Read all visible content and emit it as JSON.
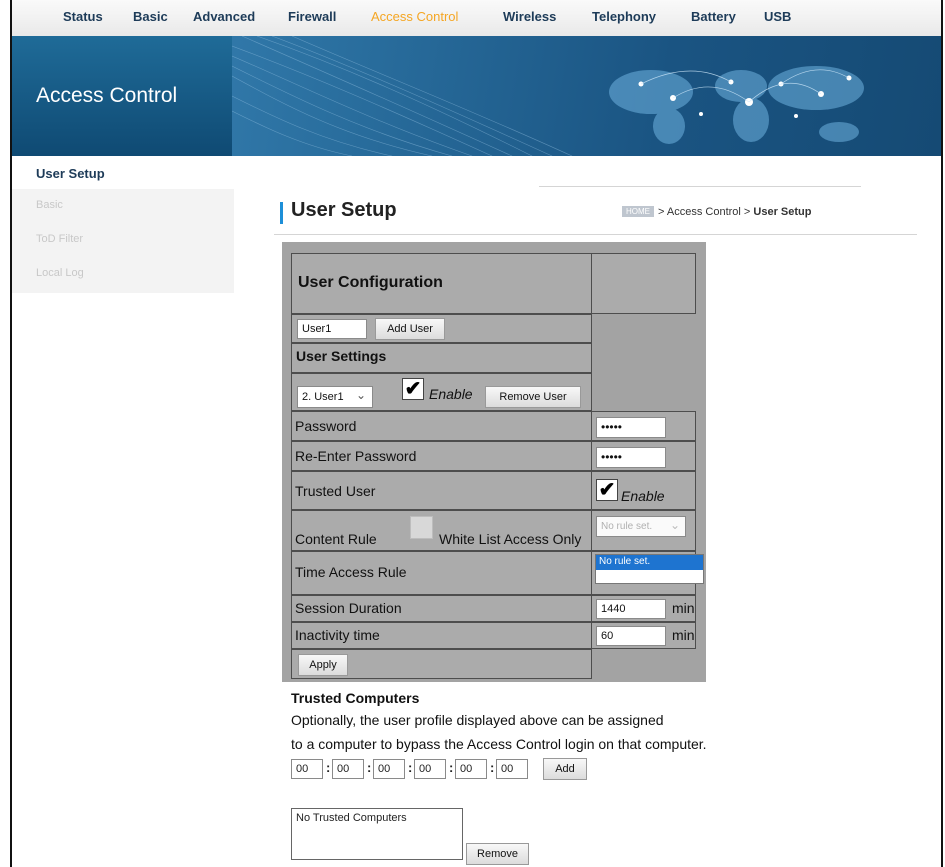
{
  "nav": {
    "items": [
      "Status",
      "Basic",
      "Advanced",
      "Firewall",
      "Access Control",
      "Wireless",
      "Telephony",
      "Battery",
      "USB"
    ],
    "active": "Access Control",
    "active_color": "#f5a623"
  },
  "banner": {
    "title": "Access Control"
  },
  "sidebar": {
    "active": "User Setup",
    "items": [
      "Basic",
      "ToD Filter",
      "Local Log"
    ]
  },
  "page": {
    "title": "User Setup",
    "breadcrumb": {
      "home": "HOME",
      "path": "> Access Control > ",
      "current": "User Setup"
    }
  },
  "user_config": {
    "title": "User Configuration",
    "new_user_value": "User1",
    "add_user_label": "Add User",
    "settings_title": "User Settings",
    "selected_user": "2. User1",
    "enable_checked": true,
    "enable_label": "Enable",
    "remove_user_label": "Remove User",
    "password_label": "Password",
    "password_value": "•••••",
    "reenter_label": "Re-Enter Password",
    "reenter_value": "•••••",
    "trusted_label": "Trusted User",
    "trusted_checked": true,
    "trusted_enable_label": "Enable",
    "content_rule_label": "Content Rule",
    "whitelist_label": "White List Access Only",
    "content_rule_select": "No rule set.",
    "time_rule_label": "Time Access Rule",
    "time_rule_option": "No rule set.",
    "session_label": "Session Duration",
    "session_value": "1440",
    "session_unit": "min",
    "inactivity_label": "Inactivity time",
    "inactivity_value": "60",
    "inactivity_unit": "min",
    "apply_label": "Apply"
  },
  "trusted_computers": {
    "title": "Trusted Computers",
    "line1": "Optionally, the user profile displayed above can be assigned",
    "line2": "to a computer to bypass the Access Control login on that computer.",
    "mac": [
      "00",
      "00",
      "00",
      "00",
      "00",
      "00"
    ],
    "add_label": "Add",
    "list_text": "No Trusted Computers",
    "remove_label": "Remove"
  }
}
